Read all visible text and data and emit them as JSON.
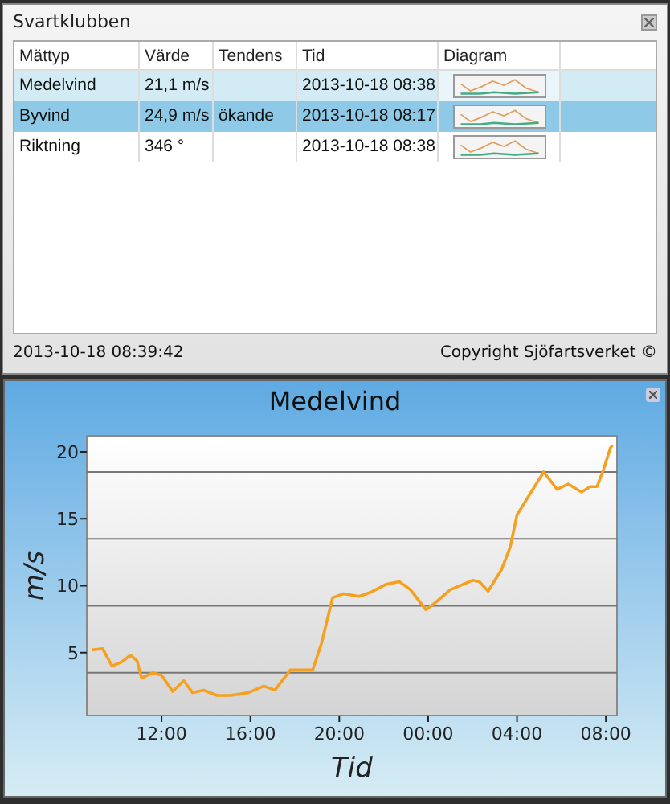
{
  "window": {
    "title": "Svartklubben"
  },
  "table": {
    "columns": [
      "Mättyp",
      "Värde",
      "Tendens",
      "Tid",
      "Diagram"
    ],
    "rows": [
      {
        "cells": [
          "Medelvind",
          "21,1 m/s",
          "",
          "2013-10-18 08:38"
        ],
        "selected": false,
        "hovered": true
      },
      {
        "cells": [
          "Byvind",
          "24,9 m/s",
          "ökande",
          "2013-10-18 08:17"
        ],
        "selected": true,
        "hovered": false
      },
      {
        "cells": [
          "Riktning",
          "346 °",
          "",
          "2013-10-18 08:38"
        ],
        "selected": false,
        "hovered": false
      }
    ]
  },
  "status_bar": {
    "timestamp": "2013-10-18 08:39:42",
    "copyright": "Copyright Sjöfartsverket ©"
  },
  "chart_window": {
    "chart_data": {
      "type": "line",
      "title": "Medelvind",
      "xlabel": "Tid",
      "ylabel": "m/s",
      "x": [
        "2013-10-17T08:52",
        "2013-10-17T09:21",
        "2013-10-17T09:46",
        "2013-10-17T10:12",
        "2013-10-17T10:36",
        "2013-10-17T10:54",
        "2013-10-17T11:06",
        "2013-10-17T11:36",
        "2013-10-17T12:00",
        "2013-10-17T12:30",
        "2013-10-17T13:00",
        "2013-10-17T13:24",
        "2013-10-17T13:54",
        "2013-10-17T14:30",
        "2013-10-17T15:06",
        "2013-10-17T15:54",
        "2013-10-17T16:36",
        "2013-10-17T17:06",
        "2013-10-17T17:48",
        "2013-10-17T18:48",
        "2013-10-17T19:12",
        "2013-10-17T19:42",
        "2013-10-17T20:12",
        "2013-10-17T20:54",
        "2013-10-17T21:24",
        "2013-10-17T22:06",
        "2013-10-17T22:42",
        "2013-10-17T23:12",
        "2013-10-17T23:54",
        "2013-10-18T00:18",
        "2013-10-18T01:00",
        "2013-10-18T02:00",
        "2013-10-18T02:18",
        "2013-10-18T02:42",
        "2013-10-18T03:18",
        "2013-10-18T03:42",
        "2013-10-18T04:00",
        "2013-10-18T04:36",
        "2013-10-18T05:12",
        "2013-10-18T05:48",
        "2013-10-18T06:18",
        "2013-10-18T06:54",
        "2013-10-18T07:18",
        "2013-10-18T07:36",
        "2013-10-18T07:54",
        "2013-10-18T08:12",
        "2013-10-18T08:18"
      ],
      "series": [
        {
          "color": "#f5a01e",
          "values": [
            5.2,
            5.3,
            4.0,
            4.3,
            4.8,
            4.4,
            3.1,
            3.5,
            3.3,
            2.1,
            2.9,
            2.0,
            2.2,
            1.8,
            1.8,
            2.0,
            2.5,
            2.2,
            3.7,
            3.7,
            5.7,
            9.1,
            9.4,
            9.2,
            9.5,
            10.1,
            10.3,
            9.7,
            8.2,
            8.7,
            9.7,
            10.4,
            10.3,
            9.6,
            11.2,
            12.9,
            15.3,
            16.9,
            18.5,
            17.2,
            17.6,
            17.0,
            17.4,
            17.4,
            18.7,
            20.3,
            20.5
          ]
        }
      ],
      "xlim": [
        "2013-10-17T08:38",
        "2013-10-18T08:30"
      ],
      "ylim": [
        0.3,
        21.2
      ],
      "xticks": [
        {
          "value": "2013-10-17T12:00",
          "label": "12:00"
        },
        {
          "value": "2013-10-17T16:00",
          "label": "16:00"
        },
        {
          "value": "2013-10-17T20:00",
          "label": "20:00"
        },
        {
          "value": "2013-10-18T00:00",
          "label": "00:00"
        },
        {
          "value": "2013-10-18T04:00",
          "label": "04:00"
        },
        {
          "value": "2013-10-18T08:00",
          "label": "08:00"
        }
      ],
      "yticks": [
        5,
        10,
        15,
        20
      ]
    }
  }
}
